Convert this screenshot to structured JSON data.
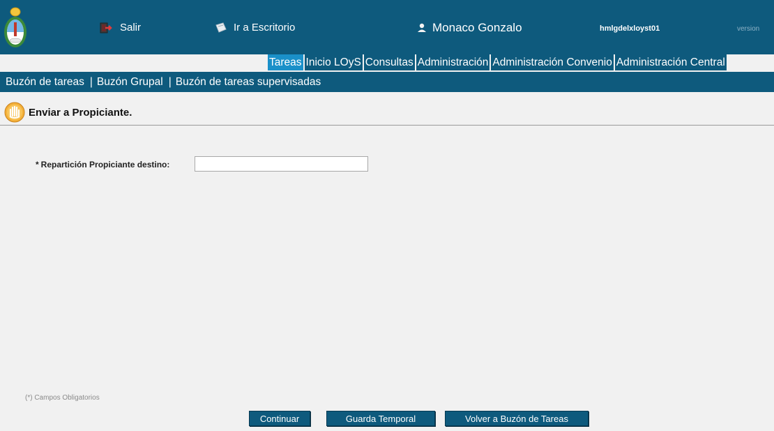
{
  "header": {
    "logo_icon": "argentina-coat-of-arms-icon",
    "salir_label": "Salir",
    "escritorio_label": "Ir a Escritorio",
    "user_name": "Monaco Gonzalo",
    "hostname": "hmlgdelxloyst01",
    "version_label": "version"
  },
  "menu": {
    "tabs": [
      {
        "label": "Tareas",
        "active": true
      },
      {
        "label": "Inicio LOyS",
        "active": false
      },
      {
        "label": "Consultas",
        "active": false
      },
      {
        "label": "Administración",
        "active": false
      },
      {
        "label": "Administración Convenio",
        "active": false
      },
      {
        "label": "Administración Central",
        "active": false
      }
    ]
  },
  "submenu": {
    "items": [
      "Buzón de tareas",
      "Buzón Grupal",
      "Buzón de tareas supervisadas"
    ],
    "separator": "|"
  },
  "page": {
    "title": "Enviar a Propiciante.",
    "title_icon": "wizard-hand-icon"
  },
  "form": {
    "required_mark": "*",
    "field_label": "Repartición Propiciante destino:",
    "field_value": "",
    "required_note": "(*) Campos Obligatorios"
  },
  "buttons": {
    "continuar": "Continuar",
    "guarda_temporal": "Guarda Temporal",
    "volver": "Volver a Buzón de Tareas"
  },
  "colors": {
    "header_bg": "#0e5a7d",
    "active_tab": "#1a90c9",
    "page_bg": "#f1f1f1"
  }
}
